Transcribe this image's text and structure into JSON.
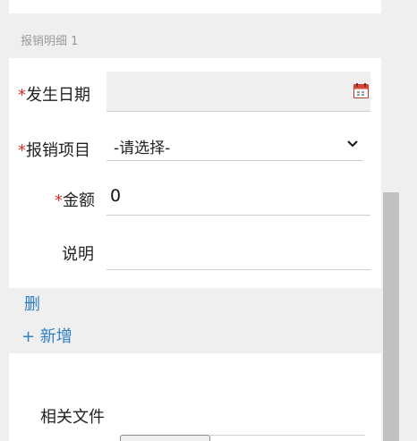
{
  "section": {
    "title": "报销明细 1"
  },
  "fields": {
    "date": {
      "required_mark": "*",
      "label": "发生日期",
      "value": ""
    },
    "item": {
      "required_mark": "*",
      "label": "报销项目",
      "selected": "-请选择-"
    },
    "amount": {
      "required_mark": "*",
      "label": "金额",
      "value": "0"
    },
    "note": {
      "label": "说明",
      "value": ""
    }
  },
  "actions": {
    "delete_label": "删",
    "add_label": "+ 新增"
  },
  "attachments": {
    "label": "相关文件"
  },
  "icons": {
    "calendar": "calendar-icon",
    "select": "chevron-down-icon"
  },
  "colors": {
    "required": "#d9302c",
    "link": "#2f7ec4",
    "band": "#efefef"
  }
}
